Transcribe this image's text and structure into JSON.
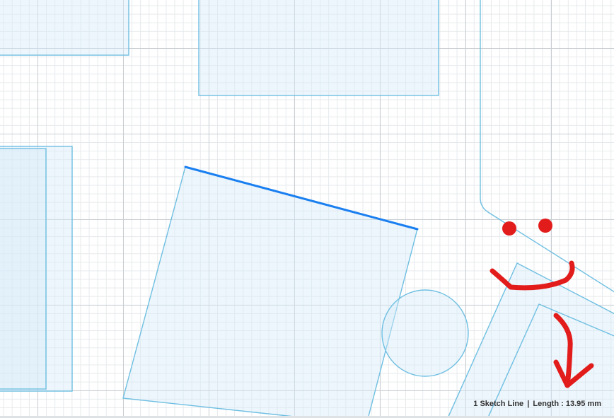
{
  "canvas": {
    "grid_major_color": "#c9ced3",
    "grid_minor_color": "#e6e9ec",
    "body_stroke_color": "#6fbfe2",
    "selected_line_color": "#1a7ff0",
    "annotation_color": "#e21b1b"
  },
  "status": {
    "selection_count": "1",
    "selection_type": "Sketch Line",
    "separator": "|",
    "length_label": "Length :",
    "length_value": "13.95 mm"
  }
}
